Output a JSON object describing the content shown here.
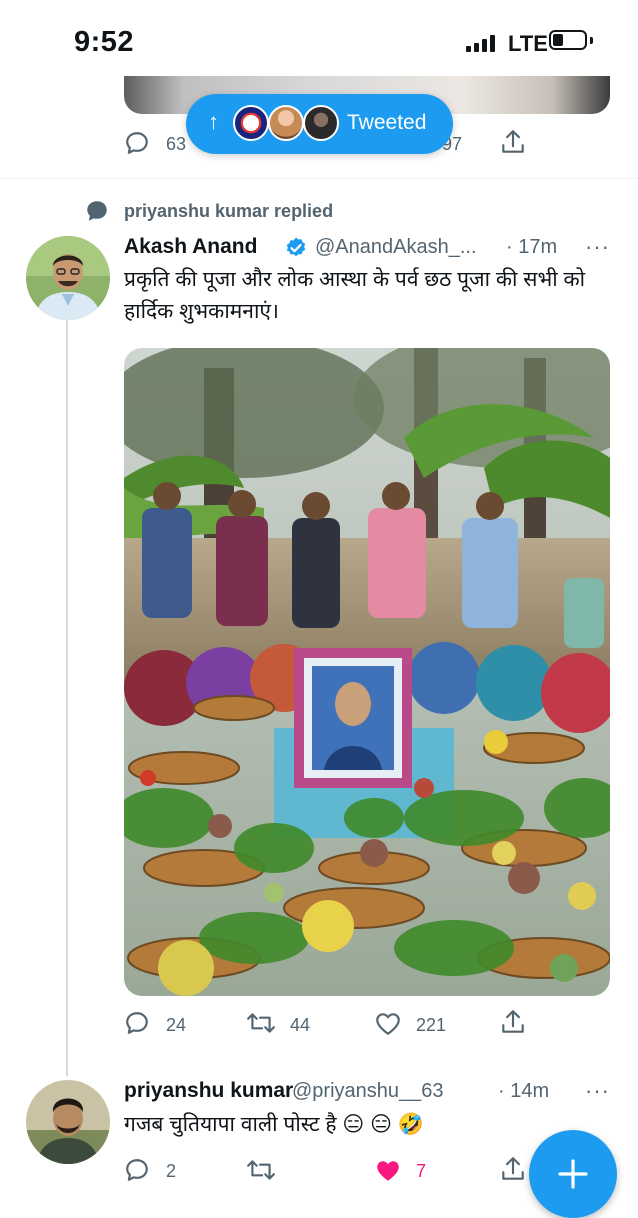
{
  "status_bar": {
    "time": "9:52",
    "network": "LTE"
  },
  "prev_tweet": {
    "reply_count": "63",
    "like_count": "97"
  },
  "tweeted_pill": {
    "label": "Tweeted",
    "arrow": "↑"
  },
  "context": {
    "text": "priyanshu kumar replied"
  },
  "main_tweet": {
    "name": "Akash Anand",
    "handle": "@AnandAkash_...",
    "time": "· 17m",
    "text": "प्रकृति की पूजा और लोक आस्था के पर्व छठ पूजा की सभी को हार्दिक शुभकामनाएं।",
    "reply_count": "24",
    "retweet_count": "44",
    "like_count": "221"
  },
  "reply_tweet": {
    "name": "priyanshu kumar",
    "handle": "@priyanshu__63",
    "time": "· 14m",
    "text": "गजब चुतियापा वाली पोस्ट है 😑 😑 🤣",
    "reply_count": "2",
    "retweet_count": "",
    "like_count": "7"
  },
  "colors": {
    "accent": "#1d9bf0",
    "muted": "#536471",
    "like_active": "#f91880",
    "verified": "#1d9bf0"
  },
  "icons": [
    "signal-icon",
    "battery-icon",
    "arrow-up-icon",
    "reply-icon",
    "retweet-icon",
    "like-icon",
    "share-icon",
    "verified-icon",
    "more-icon",
    "compose-plus-icon",
    "speech-bubble-icon"
  ]
}
